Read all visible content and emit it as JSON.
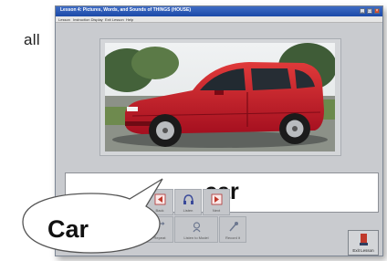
{
  "background": {
    "text": "all"
  },
  "window": {
    "title": "Lesson 4: Pictures, Words, and Sounds of THINGS (HOUSE)",
    "controls": [
      "_",
      "□",
      "×"
    ],
    "menu": [
      "Lesson",
      "Instruction Display",
      "Exit Lesson",
      "Help"
    ]
  },
  "picture": {
    "subject": "red hatchback car",
    "icon": "car-photo"
  },
  "word": "car",
  "toolbar": [
    {
      "label": "Back",
      "icon": "back-arrow-icon",
      "color": "#c0392b"
    },
    {
      "label": "Listen",
      "icon": "headphones-icon",
      "color": "#3a4a9a"
    },
    {
      "label": "Next",
      "icon": "next-arrow-icon",
      "color": "#c0392b"
    },
    {
      "label": "Repeat",
      "icon": "repeat-icon",
      "color": "#6d7890"
    },
    {
      "label": "Listen to Model",
      "icon": "model-icon",
      "color": "#6d7890"
    },
    {
      "label": "Record it",
      "icon": "microphone-icon",
      "color": "#6d7890"
    }
  ],
  "exit": {
    "label": "Exit Lesson",
    "icon": "exit-door-icon",
    "color": "#c0392b"
  },
  "callout": {
    "text": "Car"
  },
  "colors": {
    "title_bar": "#1b49a8",
    "window_bg": "#c9cbcf",
    "car_red": "#c8102e"
  }
}
